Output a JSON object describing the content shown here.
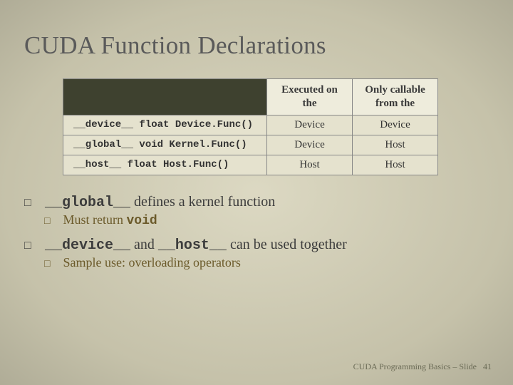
{
  "title": "CUDA Function Declarations",
  "table": {
    "headers": [
      "Executed on the",
      "Only callable from the"
    ],
    "rows": [
      {
        "qualifier": "__device__",
        "rest": " float Device.Func()",
        "exec": "Device",
        "call": "Device"
      },
      {
        "qualifier": "__global__",
        "rest": " void Kernel.Func()",
        "exec": "Device",
        "call": "Host"
      },
      {
        "qualifier": "__host__",
        "rest": " float Host.Func()",
        "exec": "Host",
        "call": "Host"
      }
    ]
  },
  "bullets": {
    "b1": {
      "code": "__global__",
      "text": " defines a kernel function",
      "sub": {
        "pre": "Must return ",
        "code": "void"
      }
    },
    "b2": {
      "code1": "__device__",
      "mid": " and ",
      "code2": "__host__",
      "text": " can be used together",
      "sub": {
        "text": "Sample use: overloading operators"
      }
    }
  },
  "footer": {
    "label": "CUDA Programming Basics – Slide",
    "num": "41"
  }
}
